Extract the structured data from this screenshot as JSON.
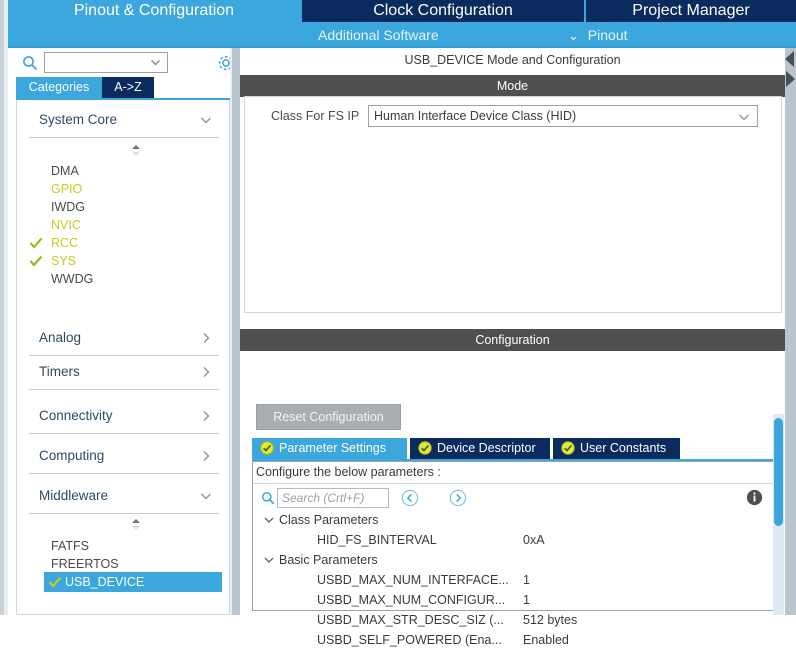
{
  "app": {
    "title": "STM32CubeMX - USB_DEVICE Configuration"
  },
  "top_tabs": {
    "items": [
      {
        "label": "Pinout & Configuration",
        "active": true
      },
      {
        "label": "Clock Configuration",
        "active": false
      },
      {
        "label": "Project Manager",
        "active": false
      }
    ],
    "sub_items": [
      {
        "label": "Additional Software",
        "icon": ""
      },
      {
        "label": "Pinout",
        "icon": "chevron-down-icon"
      }
    ]
  },
  "sidebar": {
    "search": {
      "value": "",
      "placeholder": ""
    },
    "gear_icon": "gear-icon",
    "search_icon": "search-icon",
    "view_tabs": [
      {
        "label": "Categories",
        "selected": true
      },
      {
        "label": "A->Z",
        "selected": false
      }
    ],
    "groups": [
      {
        "label": "System Core",
        "expanded": true,
        "arrow": "chevron-down-icon",
        "items": [
          {
            "label": "DMA",
            "state": "plain",
            "checked": false
          },
          {
            "label": "GPIO",
            "state": "configured",
            "checked": false
          },
          {
            "label": "IWDG",
            "state": "plain",
            "checked": false
          },
          {
            "label": "NVIC",
            "state": "configured",
            "checked": false
          },
          {
            "label": "RCC",
            "state": "configured",
            "checked": true
          },
          {
            "label": "SYS",
            "state": "configured",
            "checked": true
          },
          {
            "label": "WWDG",
            "state": "plain",
            "checked": false
          }
        ]
      },
      {
        "label": "Analog",
        "expanded": false,
        "arrow": "chevron-right-icon",
        "items": []
      },
      {
        "label": "Timers",
        "expanded": false,
        "arrow": "chevron-right-icon",
        "items": []
      },
      {
        "label": "Connectivity",
        "expanded": false,
        "arrow": "chevron-right-icon",
        "items": []
      },
      {
        "label": "Computing",
        "expanded": false,
        "arrow": "chevron-right-icon",
        "items": []
      },
      {
        "label": "Middleware",
        "expanded": true,
        "arrow": "chevron-down-icon",
        "items": [
          {
            "label": "FATFS",
            "state": "plain",
            "checked": false
          },
          {
            "label": "FREERTOS",
            "state": "plain",
            "checked": false
          },
          {
            "label": "USB_DEVICE",
            "state": "selected",
            "checked": true
          }
        ]
      }
    ]
  },
  "main": {
    "panel_title": "USB_DEVICE Mode and Configuration",
    "mode": {
      "band_label": "Mode",
      "class_label": "Class For FS IP",
      "class_value": "Human Interface Device Class (HID)",
      "caret_icon": "chevron-down-icon"
    },
    "configuration": {
      "band_label": "Configuration",
      "reset_label": "Reset Configuration",
      "tabs": [
        {
          "label": "Parameter Settings",
          "selected": true,
          "icon": "check-circle-icon"
        },
        {
          "label": "Device Descriptor",
          "selected": false,
          "icon": "check-circle-icon"
        },
        {
          "label": "User Constants",
          "selected": false,
          "icon": "check-circle-icon"
        }
      ],
      "hint": "Configure the below parameters :",
      "search": {
        "value": "",
        "placeholder": "Search (Crtl+F)"
      },
      "search_icon": "search-icon",
      "prev_icon": "nav-prev-icon",
      "next_icon": "nav-next-icon",
      "info_icon": "info-icon",
      "rows": [
        {
          "type": "group",
          "label": "Class Parameters",
          "value": "",
          "twisty": "chevron-down-icon"
        },
        {
          "type": "param",
          "label": "HID_FS_BINTERVAL",
          "value": "0xA"
        },
        {
          "type": "group",
          "label": "Basic Parameters",
          "value": "",
          "twisty": "chevron-down-icon"
        },
        {
          "type": "param",
          "label": "USBD_MAX_NUM_INTERFACE...",
          "value": "1"
        },
        {
          "type": "param",
          "label": "USBD_MAX_NUM_CONFIGUR...",
          "value": "1"
        },
        {
          "type": "param",
          "label": "USBD_MAX_STR_DESC_SIZ (...",
          "value": "512 bytes"
        },
        {
          "type": "param",
          "label": "USBD_SELF_POWERED (Ena...",
          "value": "Enabled"
        }
      ]
    }
  },
  "colors": {
    "accent_blue": "#3ba7dd",
    "tab_navy": "#0a2b5e",
    "band_gray": "#4d4f51",
    "configured_green": "#c8cc1e",
    "check_green": "#8fbf1f",
    "splitter": "#b8c4ce"
  }
}
